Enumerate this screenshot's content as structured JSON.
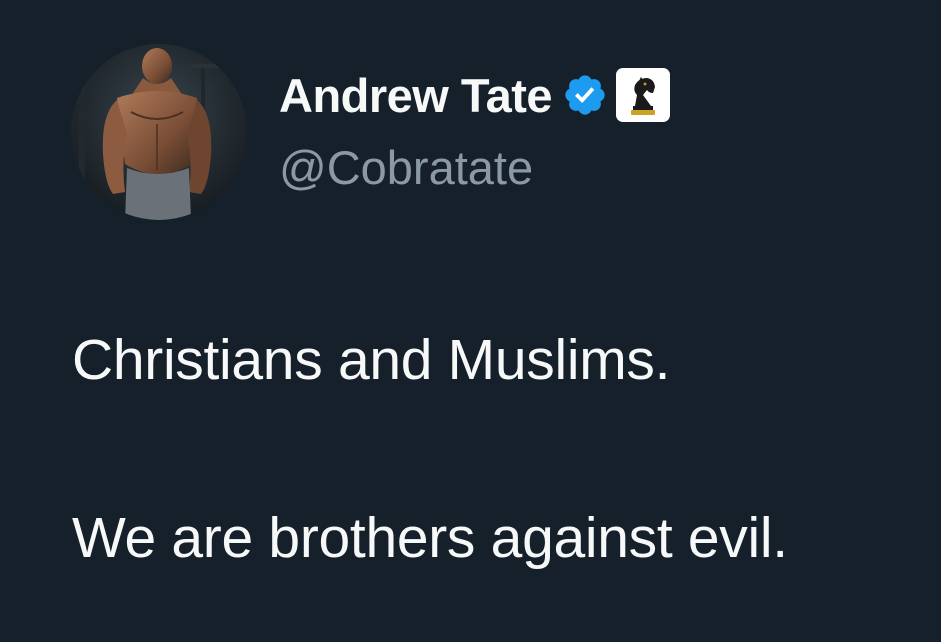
{
  "author": {
    "display_name": "Andrew Tate",
    "handle": "@Cobratate",
    "avatar": "profile-photo-shirtless-man-gym",
    "badges": [
      "verified-badge-icon",
      "chess-knight-affiliate-icon"
    ]
  },
  "tweet": {
    "lines": [
      "Christians and Muslims.",
      "We are brothers against evil."
    ]
  },
  "colors": {
    "background": "#15202b",
    "primary_text": "#f7f9f9",
    "secondary_text": "#8b98a5",
    "verified_blue": "#1d9bf0"
  }
}
